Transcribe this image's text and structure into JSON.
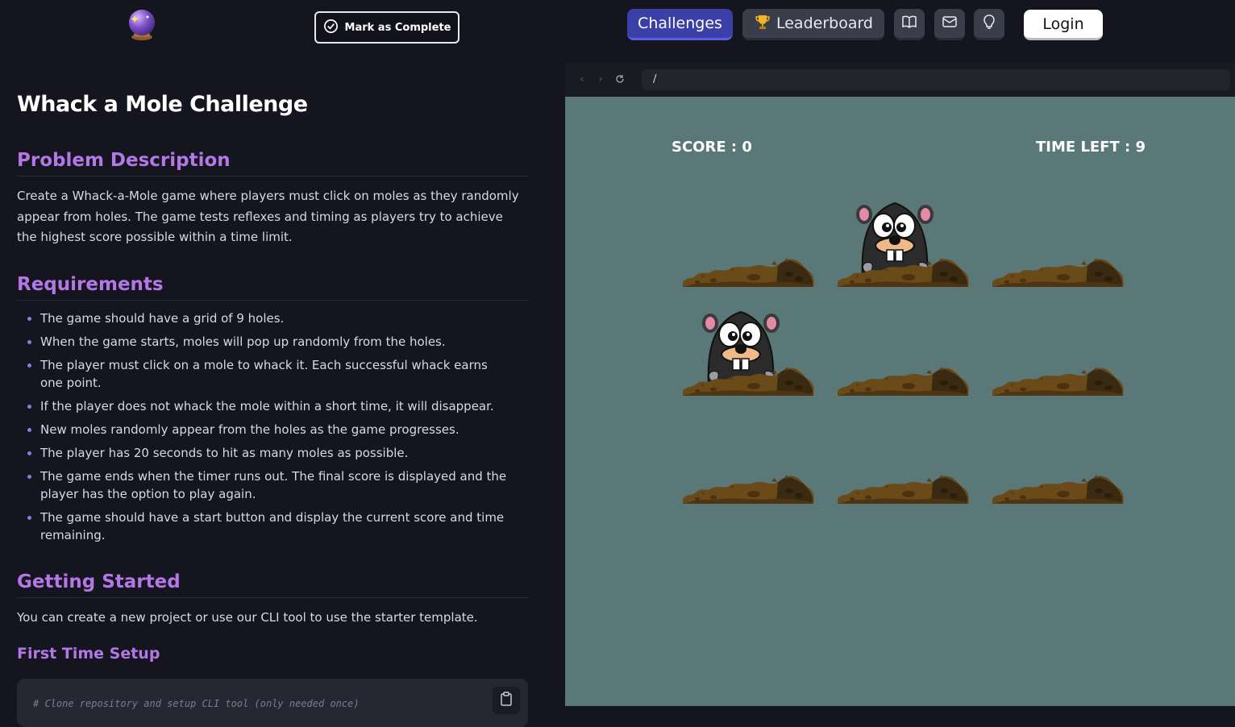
{
  "header": {
    "mark_complete_label": "Mark as Complete",
    "nav": {
      "challenges_label": "Challenges",
      "leaderboard_label": "Leaderboard",
      "login_label": "Login"
    },
    "icons": [
      "crystal-ball-icon",
      "check-circle-icon",
      "trophy-icon",
      "book-icon",
      "mail-icon",
      "lightbulb-icon"
    ]
  },
  "content": {
    "title": "Whack a Mole Challenge",
    "problem_heading": "Problem Description",
    "problem_text": "Create a Whack-a-Mole game where players must click on moles as they randomly appear from holes. The game tests reflexes and timing as players try to achieve the highest score possible within a time limit.",
    "requirements_heading": "Requirements",
    "requirements": [
      "The game should have a grid of 9 holes.",
      "When the game starts, moles will pop up randomly from the holes.",
      "The player must click on a mole to whack it. Each successful whack earns one point.",
      "If the player does not whack the mole within a short time, it will disappear.",
      "New moles randomly appear from the holes as the game progresses.",
      "The player has 20 seconds to hit as many moles as possible.",
      "The game ends when the timer runs out. The final score is displayed and the player has the option to play again.",
      "The game should have a start button and display the current score and time remaining."
    ],
    "getting_started_heading": "Getting Started",
    "getting_started_text": "You can create a new project or use our CLI tool to use the starter template.",
    "first_time_setup_heading": "First Time Setup",
    "code_comment": "# Clone repository and setup CLI tool (only needed once)"
  },
  "preview": {
    "url": "/",
    "score_text": "SCORE : 0",
    "time_left_text": "TIME LEFT : 9",
    "grid": {
      "rows": 3,
      "cols": 3,
      "moles_visible_at": [
        1,
        3
      ]
    },
    "colors": {
      "accent": "#b477e6",
      "primary_button": "#3b3fa8",
      "game_background": "#5a7877",
      "dirt": "#6b4a1a"
    }
  }
}
